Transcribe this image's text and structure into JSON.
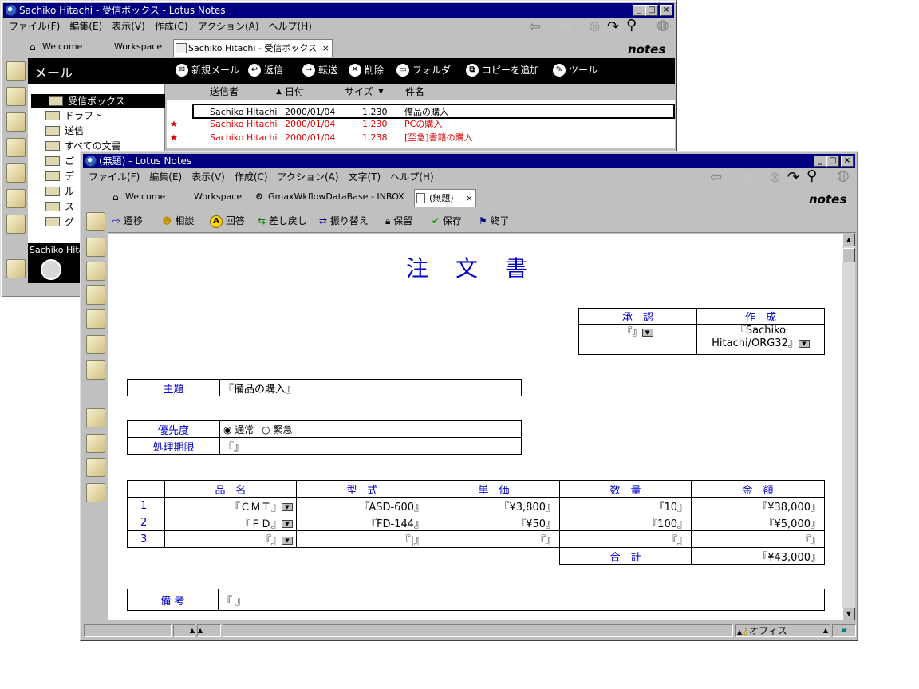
{
  "back_window": {
    "title": "Sachiko Hitachi - 受信ボックス - Lotus Notes",
    "menu": [
      "ファイル(F)",
      "編集(E)",
      "表示(V)",
      "作成(C)",
      "アクション(A)",
      "ヘルプ(H)"
    ],
    "tabs": [
      "Welcome",
      "Workspace",
      "Sachiko Hitachi - 受信ボックス"
    ],
    "brand": "notes",
    "section_title": "メール",
    "toolbar": [
      "新規メール",
      "返信",
      "転送",
      "削除",
      "フォルダ",
      "コピーを追加",
      "ツール"
    ],
    "nav_items": [
      "受信ボックス",
      "ドラフト",
      "送信",
      "すべての文書",
      "ご",
      "デ",
      "ル",
      "ス",
      "グ"
    ],
    "footer_user": "Sachiko Hita",
    "columns": [
      "送信者",
      "日付",
      "サイズ",
      "件名"
    ],
    "rows": [
      {
        "sender": "Sachiko Hitachi",
        "date": "2000/01/04",
        "size": "1,230",
        "subject": "備品の購入",
        "unread": false
      },
      {
        "sender": "Sachiko Hitachi",
        "date": "2000/01/04",
        "size": "1,230",
        "subject": "PCの購入",
        "unread": true
      },
      {
        "sender": "Sachiko Hitachi",
        "date": "2000/01/04",
        "size": "1,238",
        "subject": "[至急]書籍の購入",
        "unread": true
      }
    ]
  },
  "front_window": {
    "title": "(無題) - Lotus Notes",
    "menu": [
      "ファイル(F)",
      "編集(E)",
      "表示(V)",
      "作成(C)",
      "アクション(A)",
      "文字(T)",
      "ヘルプ(H)"
    ],
    "tabs": [
      "Welcome",
      "Workspace",
      "GmaxWkflowDataBase - INBOX",
      "(無題)"
    ],
    "brand": "notes",
    "actions": [
      "遷移",
      "相談",
      "回答",
      "差し戻し",
      "振り替え",
      "保留",
      "保存",
      "終了"
    ],
    "form": {
      "title": "注文書",
      "approval_headers": [
        "承　認",
        "作　成"
      ],
      "approval_values": [
        "『』",
        "『Sachiko",
        "Hitachi/ORG32』"
      ],
      "subject_label": "主題",
      "subject_value": "『備品の購入』",
      "priority_label": "優先度",
      "priority_options": [
        "通常",
        "緊急"
      ],
      "priority_selected": "通常",
      "deadline_label": "処理期限",
      "deadline_value": "『』",
      "item_headers": [
        "品　名",
        "型　式",
        "単　価",
        "数　量",
        "金　額"
      ],
      "items": [
        {
          "no": "1",
          "name": "『ＣＭＴ』",
          "model": "『ASD-600』",
          "price": "『¥3,800』",
          "qty": "『10』",
          "amount": "『¥38,000』"
        },
        {
          "no": "2",
          "name": "『ＦＤ』",
          "model": "『FD-144』",
          "price": "『¥50』",
          "qty": "『100』",
          "amount": "『¥5,000』"
        },
        {
          "no": "3",
          "name": "『』",
          "model": "『|』",
          "price": "『』",
          "qty": "『』",
          "amount": "『』"
        }
      ],
      "total_label": "合　計",
      "total_value": "『¥43,000』",
      "remarks_label": "備 考",
      "remarks_value": "『 』"
    },
    "status_location": "オフィス"
  }
}
